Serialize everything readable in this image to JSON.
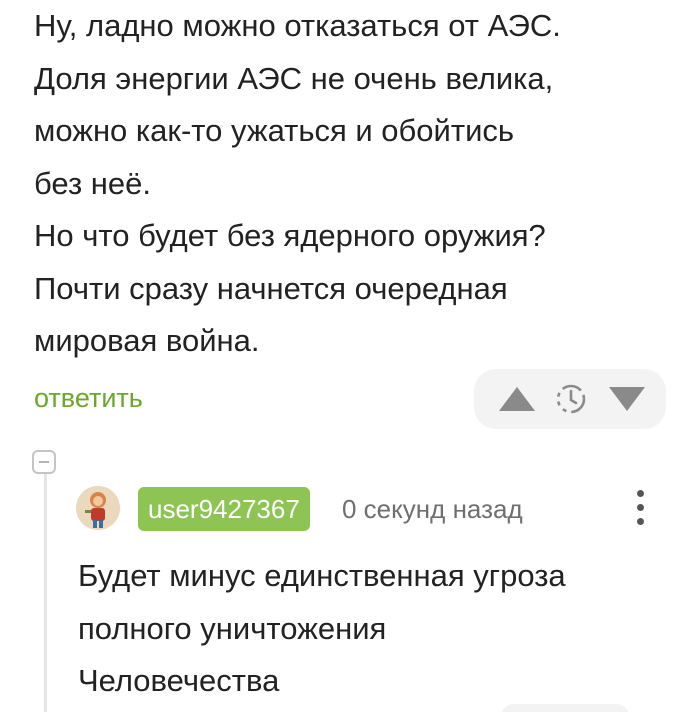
{
  "comment": {
    "lines": [
      "Ну, ладно можно отказаться от АЭС.",
      "Доля энергии АЭС не очень велика,",
      "можно как-то ужаться и обойтись",
      "без неё.",
      "Но что будет без ядерного оружия?",
      "Почти сразу начнется очередная",
      "мировая война."
    ],
    "reply_label": "ответить"
  },
  "votes": {
    "upvote_icon": "triangle-up",
    "timer_icon": "clock-dashed",
    "downvote_icon": "triangle-down"
  },
  "reply": {
    "username": "user9427367",
    "timestamp": "0 секунд назад",
    "lines": [
      "Будет минус единственная угроза",
      "полного уничтожения",
      "Человечества"
    ]
  },
  "colors": {
    "accent_green": "#6aa72b",
    "username_badge": "#8dc454",
    "vote_bg": "#f3f3f4",
    "icon_gray": "#8a8a8a"
  }
}
